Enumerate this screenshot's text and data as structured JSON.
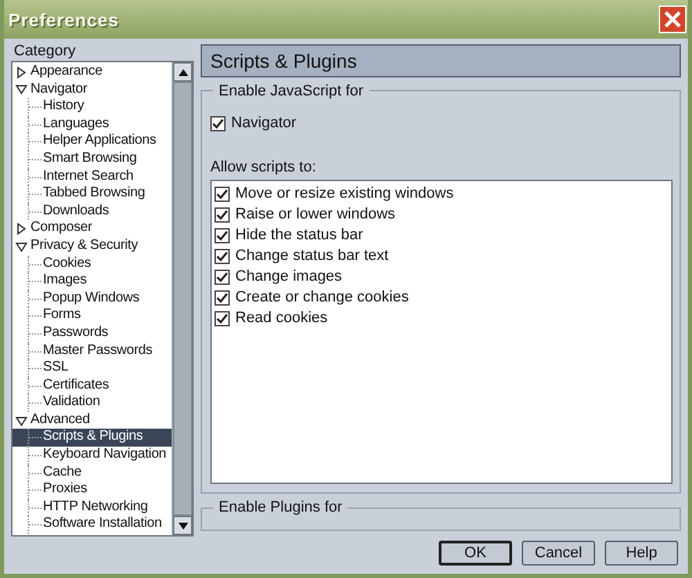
{
  "window": {
    "title": "Preferences"
  },
  "sidebar": {
    "label": "Category",
    "items": [
      {
        "label": "Appearance",
        "expanded": false,
        "selected": false
      },
      {
        "label": "Navigator",
        "expanded": true,
        "selected": false,
        "children": [
          {
            "label": "History",
            "selected": false
          },
          {
            "label": "Languages",
            "selected": false
          },
          {
            "label": "Helper Applications",
            "selected": false
          },
          {
            "label": "Smart Browsing",
            "selected": false
          },
          {
            "label": "Internet Search",
            "selected": false
          },
          {
            "label": "Tabbed Browsing",
            "selected": false
          },
          {
            "label": "Downloads",
            "selected": false
          }
        ]
      },
      {
        "label": "Composer",
        "expanded": false,
        "selected": false
      },
      {
        "label": "Privacy & Security",
        "expanded": true,
        "selected": false,
        "children": [
          {
            "label": "Cookies",
            "selected": false
          },
          {
            "label": "Images",
            "selected": false
          },
          {
            "label": "Popup Windows",
            "selected": false
          },
          {
            "label": "Forms",
            "selected": false
          },
          {
            "label": "Passwords",
            "selected": false
          },
          {
            "label": "Master Passwords",
            "selected": false
          },
          {
            "label": "SSL",
            "selected": false
          },
          {
            "label": "Certificates",
            "selected": false
          },
          {
            "label": "Validation",
            "selected": false
          }
        ]
      },
      {
        "label": "Advanced",
        "expanded": true,
        "selected": false,
        "children": [
          {
            "label": "Scripts & Plugins",
            "selected": true
          },
          {
            "label": "Keyboard Navigation",
            "selected": false
          },
          {
            "label": "Cache",
            "selected": false
          },
          {
            "label": "Proxies",
            "selected": false
          },
          {
            "label": "HTTP Networking",
            "selected": false
          },
          {
            "label": "Software Installation",
            "selected": false
          }
        ]
      }
    ]
  },
  "panel": {
    "title": "Scripts & Plugins",
    "javascript_group": {
      "legend": "Enable JavaScript for",
      "options": [
        {
          "label": "Navigator",
          "checked": true
        }
      ]
    },
    "allow_label": "Allow scripts to:",
    "allow_options": [
      {
        "label": "Move or resize existing windows",
        "checked": true
      },
      {
        "label": "Raise or lower windows",
        "checked": true
      },
      {
        "label": "Hide the status bar",
        "checked": true
      },
      {
        "label": "Change status bar text",
        "checked": true
      },
      {
        "label": "Change images",
        "checked": true
      },
      {
        "label": "Create or change cookies",
        "checked": true
      },
      {
        "label": "Read cookies",
        "checked": true
      }
    ],
    "plugins_group": {
      "legend": "Enable Plugins for"
    }
  },
  "buttons": [
    {
      "label": "OK",
      "default": true
    },
    {
      "label": "Cancel",
      "default": false
    },
    {
      "label": "Help",
      "default": false
    }
  ]
}
